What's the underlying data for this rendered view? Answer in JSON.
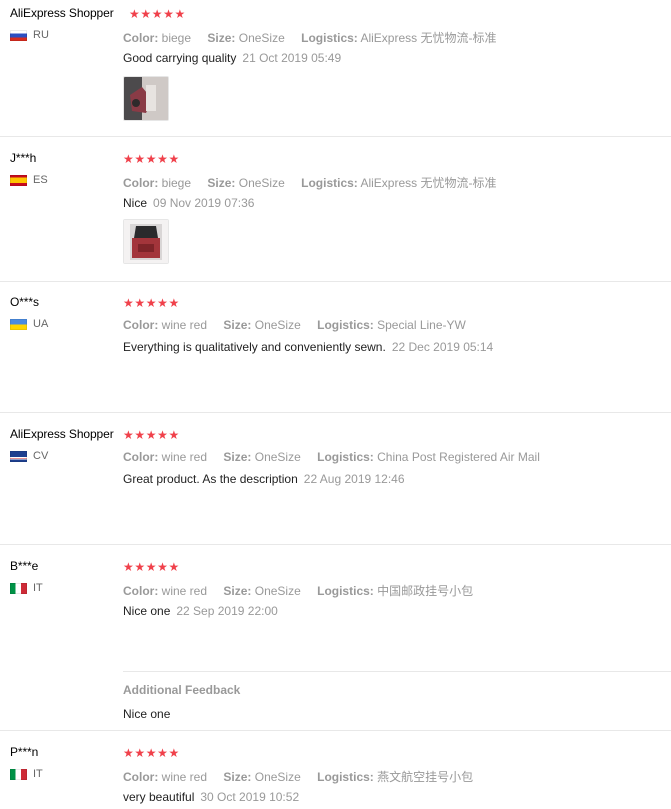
{
  "labels": {
    "color": "Color:",
    "size": "Size:",
    "logistics": "Logistics:"
  },
  "star_glyph": "★",
  "reviews": [
    {
      "user": "AliExpress Shopper",
      "country": "RU",
      "rating": 5,
      "color": "biege",
      "size": "OneSize",
      "logistics": "AliExpress 无忧物流-标准",
      "text": "Good carrying quality",
      "date": "21 Oct 2019 05:49",
      "photo_icon": "photo-thumbnail"
    },
    {
      "user": "J***h",
      "country": "ES",
      "rating": 5,
      "color": "biege",
      "size": "OneSize",
      "logistics": "AliExpress 无忧物流-标准",
      "text": "Nice",
      "date": "09 Nov 2019 07:36",
      "photo_icon": "photo-thumbnail"
    },
    {
      "user": "O***s",
      "country": "UA",
      "rating": 5,
      "color": "wine red",
      "size": "OneSize",
      "logistics": "Special Line-YW",
      "text": "Everything is qualitatively and conveniently sewn.",
      "date": "22 Dec 2019 05:14"
    },
    {
      "user": "AliExpress Shopper",
      "country": "CV",
      "rating": 5,
      "color": "wine red",
      "size": "OneSize",
      "logistics": "China Post Registered Air Mail",
      "text": "Great product. As the description",
      "date": "22 Aug 2019 12:46"
    },
    {
      "user": "B***e",
      "country": "IT",
      "rating": 5,
      "color": "wine red",
      "size": "OneSize",
      "logistics": "中国邮政挂号小包",
      "text": "Nice one",
      "date": "22 Sep 2019 22:00",
      "additional_title": "Additional Feedback",
      "additional_text": "Nice one"
    },
    {
      "user": "P***n",
      "country": "IT",
      "rating": 5,
      "color": "wine red",
      "size": "OneSize",
      "logistics": "燕文航空挂号小包",
      "text": "very beautiful",
      "date": "30 Oct 2019 10:52"
    }
  ],
  "colors": {
    "star": "#f0414b",
    "muted": "#999999",
    "text": "#222222",
    "divider": "#e8e8e8"
  }
}
